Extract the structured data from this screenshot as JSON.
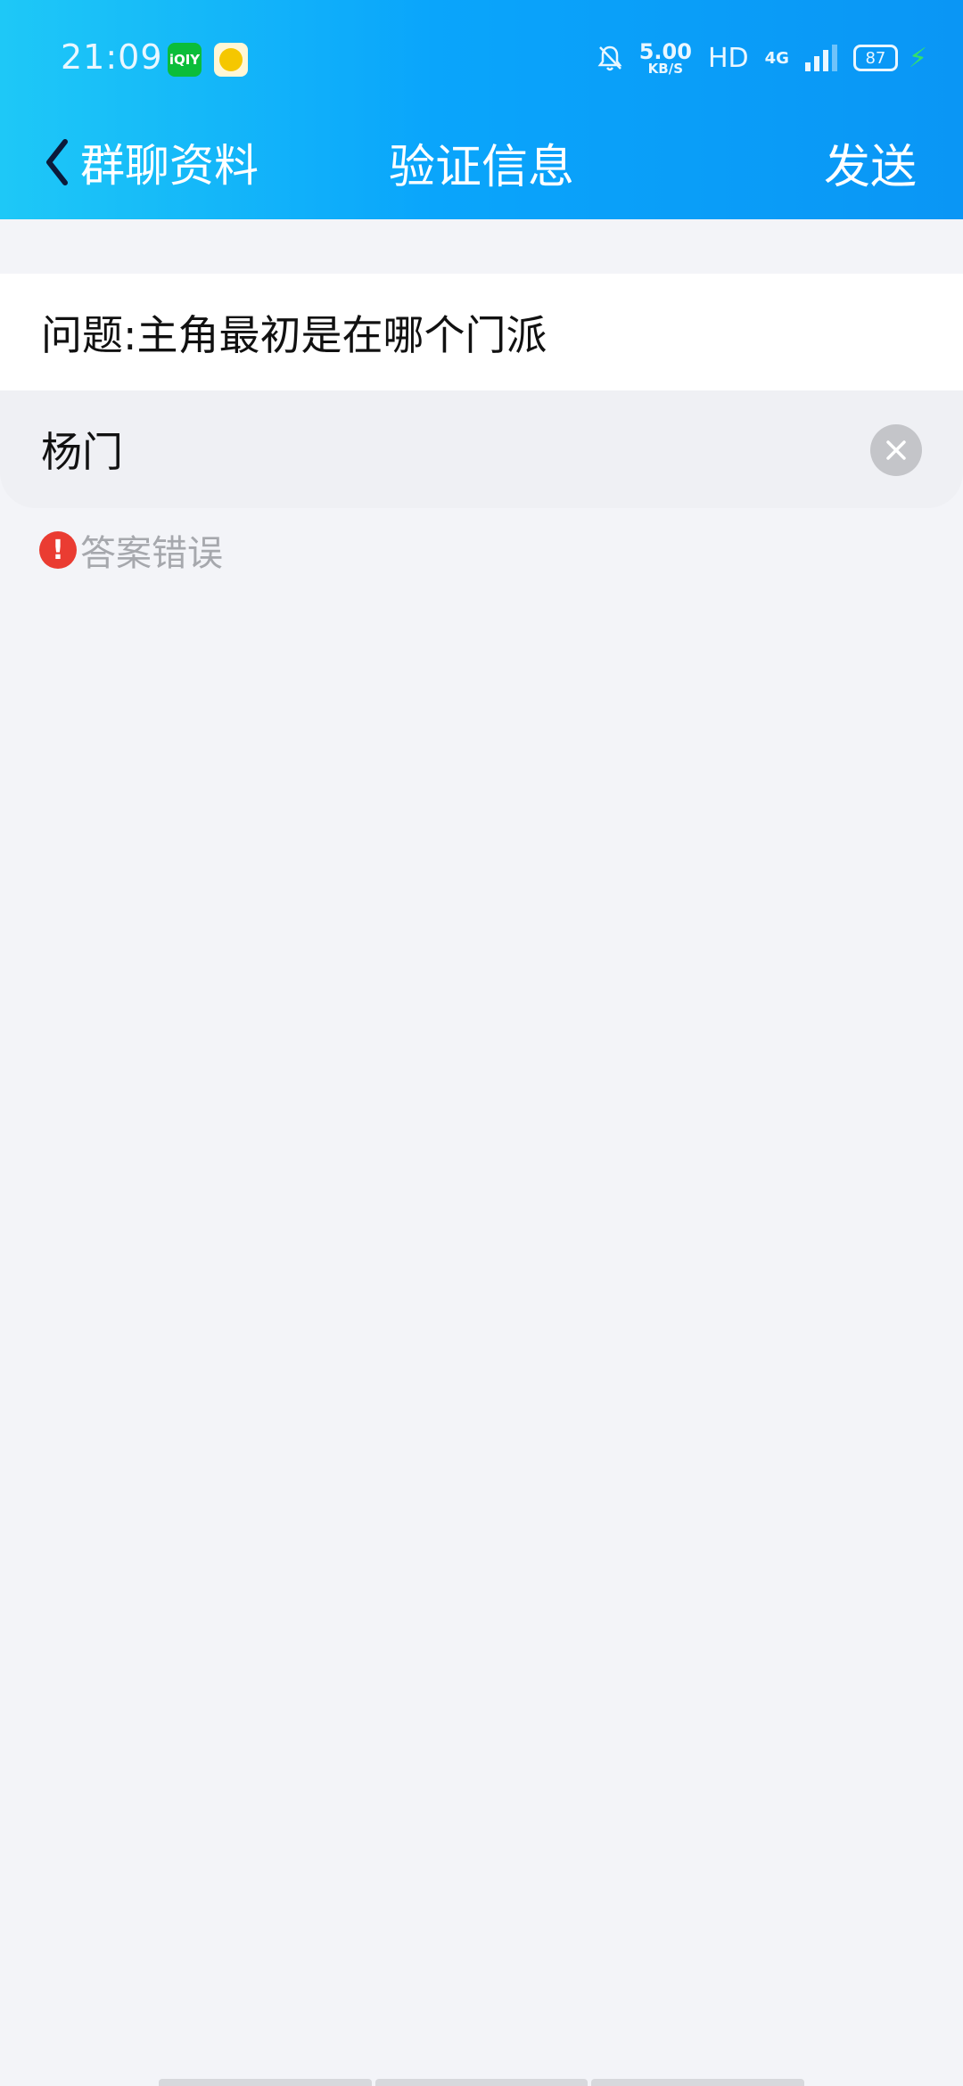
{
  "status_bar": {
    "time": "21:09",
    "app_icons": [
      "iqiyi-icon",
      "qq-music-icon"
    ],
    "iqiyi_label": "iQIY",
    "network_speed_value": "5.00",
    "network_speed_unit": "KB/S",
    "hd_label": "HD",
    "network_type": "4G",
    "battery_level": "87",
    "charging_color": "#34e06b"
  },
  "nav": {
    "back_label": "群聊资料",
    "title": "验证信息",
    "send_label": "发送"
  },
  "form": {
    "question": "问题:主角最初是在哪个门派",
    "answer": "杨门",
    "error_message": "答案错误"
  },
  "colors": {
    "header_gradient_start": "#1ec8f7",
    "header_gradient_end": "#0a96f5",
    "error_red": "#ea3c32",
    "background": "#f3f4f8"
  }
}
